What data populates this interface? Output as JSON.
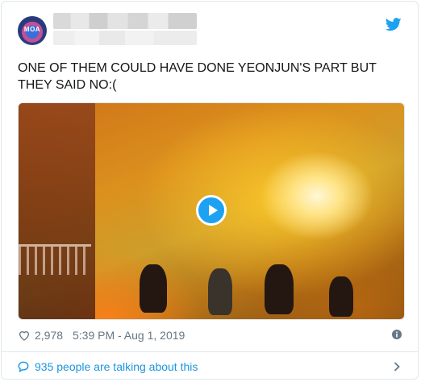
{
  "tweet": {
    "avatar_text": "MOA",
    "text": "ONE OF THEM COULD HAVE DONE YEONJUN'S PART BUT THEY SAID NO:(",
    "like_count": "2,978",
    "timestamp": "5:39 PM - Aug 1, 2019",
    "talking_text": "935 people are talking about this"
  },
  "icons": {
    "brand": "twitter-bird-icon",
    "like": "heart-icon",
    "info": "info-icon",
    "conversation": "speech-bubble-icon",
    "more": "chevron-right-icon",
    "play": "play-icon"
  },
  "colors": {
    "accent": "#1da1f2",
    "link": "#1b95e0",
    "muted": "#657786",
    "text": "#14171a",
    "border": "#e1e8ed"
  }
}
